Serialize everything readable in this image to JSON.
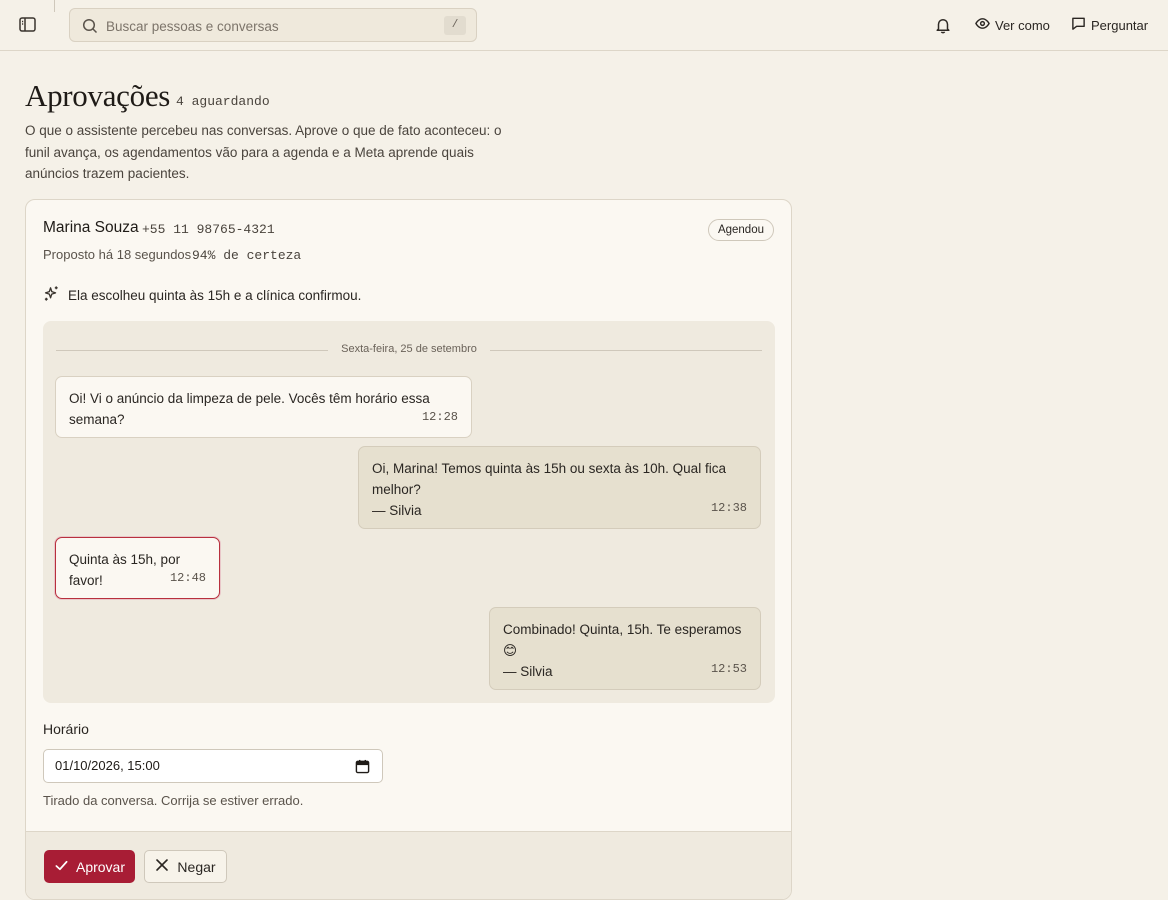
{
  "search": {
    "placeholder": "Buscar pessoas e conversas",
    "shortcut": "/"
  },
  "header": {
    "view_as_label": "Ver como",
    "ask_label": "Perguntar"
  },
  "page": {
    "title": "Aprovações",
    "waiting": "4 aguardando",
    "intro": "O que o assistente percebeu nas conversas. Aprove o que de fato aconteceu: o funil avança, os agendamentos vão para a agenda e a Meta aprende quais anúncios trazem pacientes."
  },
  "card": {
    "contact_name": "Marina Souza",
    "contact_phone": "+55 11 98765-4321",
    "status": "Agendou",
    "proposed": "Proposto há 18 segundos",
    "certainty": "94% de certeza",
    "summary": "Ela escolheu quinta às 15h e a clínica confirmou.",
    "chat": {
      "date": "Sexta-feira, 25 de setembro",
      "messages": [
        {
          "text": "Oi! Vi o anúncio da limpeza de pele. Vocês têm horário essa semana?",
          "time": "12:28"
        },
        {
          "text": "Oi, Marina! Temos quinta às 15h ou sexta às 10h. Qual fica melhor?",
          "sign": "— Silvia",
          "time": "12:38"
        },
        {
          "text": "Quinta às 15h, por favor!",
          "time": "12:48"
        },
        {
          "text": "Combinado! Quinta, 15h. Te esperamos 😊",
          "sign": "— Silvia",
          "time": "12:53"
        }
      ]
    },
    "time_field": {
      "label": "Horário",
      "value": "01/10/2026, 15:00",
      "hint": "Tirado da conversa. Corrija se estiver errado."
    },
    "actions": {
      "approve": "Aprovar",
      "deny": "Negar"
    }
  },
  "colors": {
    "accent": "#a81d35",
    "background": "#f5f1e8",
    "highlight_border": "#b8303e"
  }
}
